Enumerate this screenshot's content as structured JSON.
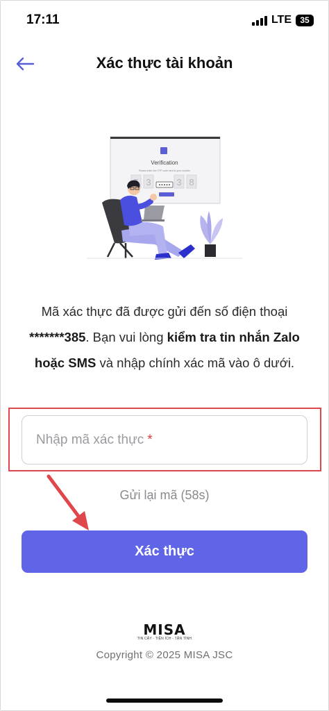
{
  "status_bar": {
    "time": "17:11",
    "network": "LTE",
    "battery": "35"
  },
  "header": {
    "title": "Xác thực tài khoản",
    "back_icon": "arrow-left-icon"
  },
  "illustration": {
    "screen_title": "Verification",
    "screen_subtitle": "Please enter the OTP code sent to your number",
    "digits": [
      "5",
      "3",
      "3",
      "8"
    ],
    "masked": "•••••"
  },
  "description": {
    "part1": "Mã xác thực đã được gửi đến số điện thoại ",
    "phone_masked": "*******385",
    "part2": ". Bạn vui lòng ",
    "bold_text": "kiểm tra tin nhắn Zalo hoặc SMS",
    "part3": " và nhập chính xác mã vào ô dưới."
  },
  "otp_input": {
    "placeholder": "Nhập mã xác thực",
    "required_mark": "*",
    "value": ""
  },
  "resend": {
    "label": "Gửi lại mã (58s)"
  },
  "verify_button": {
    "label": "Xác thực"
  },
  "footer": {
    "logo": "MISA",
    "slogan": "TIN CẬY - TIỆN ÍCH - TẬN TÌNH",
    "copyright": "Copyright © 2025 MISA JSC"
  },
  "colors": {
    "primary": "#6065e7",
    "highlight": "#e0474c",
    "arrow": "#e0474c"
  }
}
